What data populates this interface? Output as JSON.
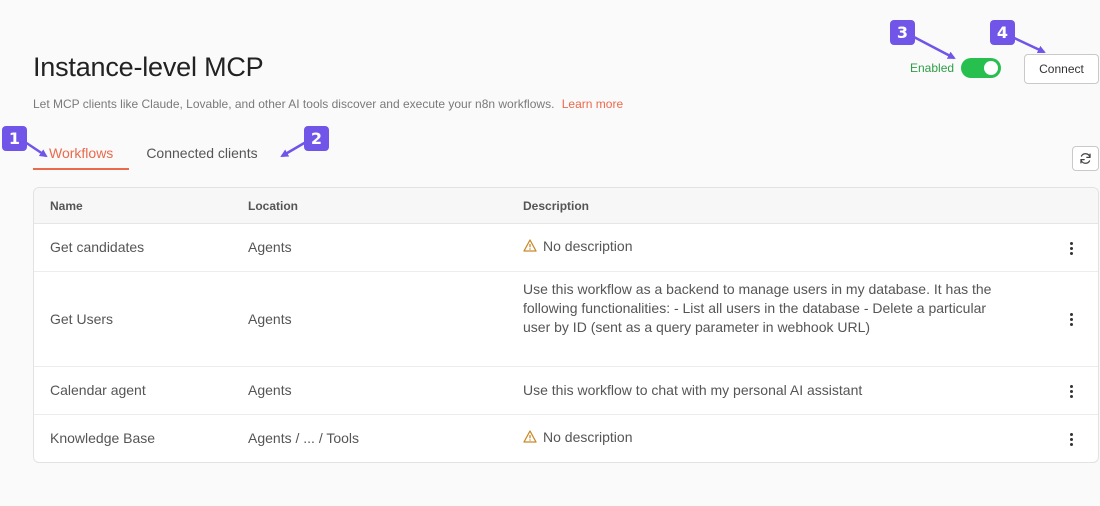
{
  "header": {
    "title": "Instance-level MCP",
    "subtitle": "Let MCP clients like Claude, Lovable, and other AI tools discover and execute your n8n workflows.",
    "learn_more": "Learn more"
  },
  "toggle": {
    "label": "Enabled",
    "state": true,
    "color": "#27c04f"
  },
  "connect_label": "Connect",
  "tabs": [
    {
      "label": "Workflows",
      "active": true
    },
    {
      "label": "Connected clients",
      "active": false
    }
  ],
  "table": {
    "headers": {
      "name": "Name",
      "location": "Location",
      "description": "Description"
    },
    "rows": [
      {
        "name": "Get candidates",
        "location": "Agents",
        "description": "No description",
        "warning": true
      },
      {
        "name": "Get Users",
        "location": "Agents",
        "description": "Use this workflow as a backend to manage users in my database. It has the following functionalities: - List all users in the database - Delete a particular user by ID (sent as a query parameter in webhook URL)",
        "warning": false
      },
      {
        "name": "Calendar agent",
        "location": "Agents",
        "description": "Use this workflow to chat with my personal AI assistant",
        "warning": false
      },
      {
        "name": "Knowledge Base",
        "location": "Agents / ... / Tools",
        "description": "No description",
        "warning": true
      }
    ]
  },
  "annotations": [
    "1",
    "2",
    "3",
    "4"
  ],
  "colors": {
    "accent": "#ea6a4c",
    "annotation": "#7055e8",
    "enabled": "#2e9e48"
  }
}
